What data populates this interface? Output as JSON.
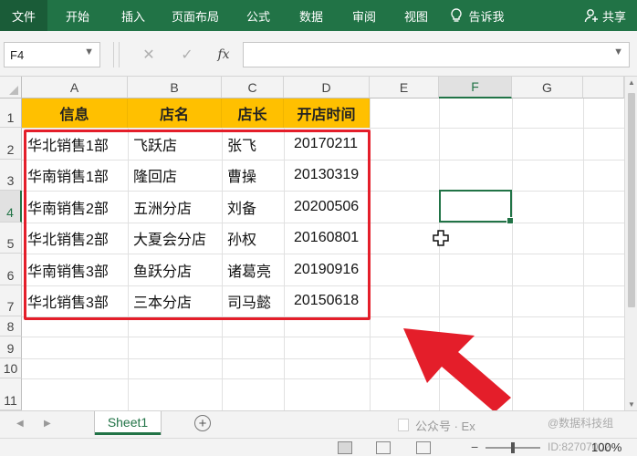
{
  "ribbon": {
    "tabs": [
      "文件",
      "开始",
      "插入",
      "页面布局",
      "公式",
      "数据",
      "审阅",
      "视图"
    ],
    "tell_me": "告诉我",
    "share": "共享"
  },
  "formula_bar": {
    "name_box": "F4",
    "formula": "",
    "fx_label": "fx"
  },
  "columns": [
    "A",
    "B",
    "C",
    "D",
    "E",
    "F",
    "G"
  ],
  "rows": [
    "1",
    "2",
    "3",
    "4",
    "5",
    "6",
    "7",
    "8",
    "9",
    "10",
    "11"
  ],
  "table": {
    "headers": [
      "信息",
      "店名",
      "店长",
      "开店时间"
    ],
    "rows": [
      [
        "华北销售1部",
        "飞跃店",
        "张飞",
        "20170211"
      ],
      [
        "华南销售1部",
        "隆回店",
        "曹操",
        "20130319"
      ],
      [
        "华南销售2部",
        "五洲分店",
        "刘备",
        "20200506"
      ],
      [
        "华北销售2部",
        "大夏会分店",
        "孙权",
        "20160801"
      ],
      [
        "华南销售3部",
        "鱼跃分店",
        "诸葛亮",
        "20190916"
      ],
      [
        "华北销售3部",
        "三本分店",
        "司马懿",
        "20150618"
      ]
    ]
  },
  "selected_cell": "F4",
  "accent_color": "#217346",
  "highlight_color": "#ffc000",
  "annotation_color": "#e41e2a",
  "sheet_tabs": [
    "Sheet1"
  ],
  "watermark": {
    "line1": "公众号 · Ex",
    "line2": "@数据科技组",
    "line3": "ID:82707002"
  },
  "zoom": "100%",
  "icons": [
    "lightbulb-icon",
    "person-icon",
    "dropdown-icon",
    "cancel-icon",
    "confirm-icon",
    "add-sheet-icon",
    "cursor-plus-icon",
    "red-arrow-icon"
  ]
}
